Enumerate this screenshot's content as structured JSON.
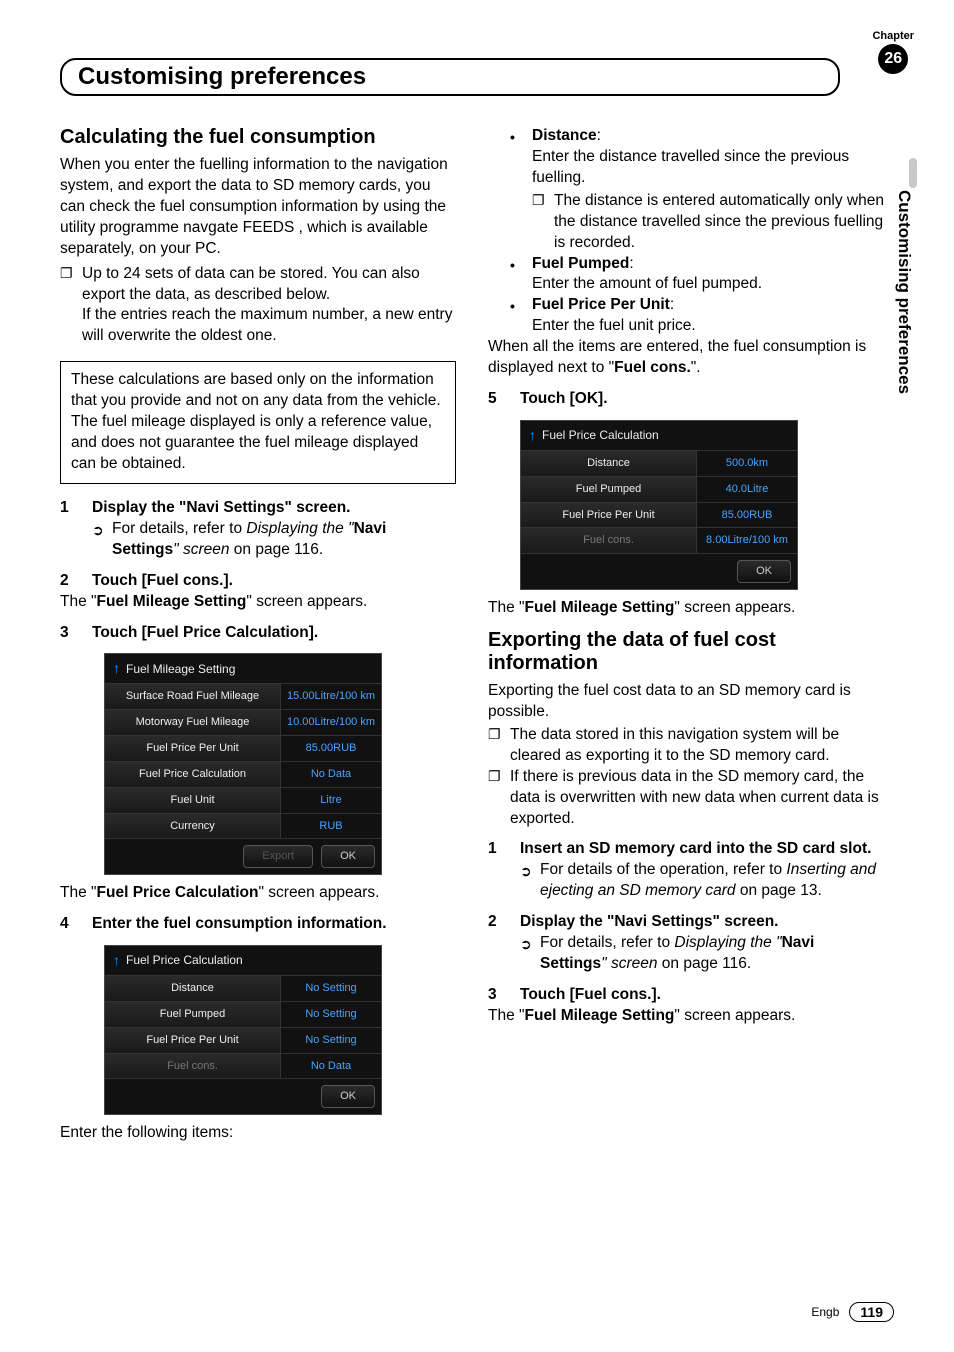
{
  "chapter": {
    "label": "Chapter",
    "number": "26"
  },
  "page_title": "Customising preferences",
  "side_label": "Customising preferences",
  "footer": {
    "lang": "Engb",
    "page": "119"
  },
  "left": {
    "h2": "Calculating the fuel consumption",
    "intro": "When you enter the fuelling information to the navigation system, and export the data to SD memory cards, you can check the fuel consumption information by using the utility programme navgate FEEDS , which is available separately, on your PC.",
    "note1a": "Up to 24 sets of data can be stored. You can also export the data, as described below.",
    "note1b": "If the entries reach the maximum number, a new entry will overwrite the oldest one.",
    "boxed": "These calculations are based only on the information that you provide and not on any data from the vehicle. The fuel mileage displayed is only a reference value, and does not guarantee the fuel mileage displayed can be obtained.",
    "step1": "Display the \"Navi Settings\" screen.",
    "step1_ref_a": "For details, refer to ",
    "step1_ref_i": "Displaying the \"",
    "step1_ref_b": "Navi Settings",
    "step1_ref_c": "\" screen",
    "step1_ref_d": " on page 116.",
    "step2": "Touch [Fuel cons.].",
    "step2_after_a": "The \"",
    "step2_after_b": "Fuel Mileage Setting",
    "step2_after_c": "\" screen appears.",
    "step3": "Touch [Fuel Price Calculation].",
    "ss1": {
      "title": "Fuel Mileage Setting",
      "rows": [
        {
          "k": "Surface Road Fuel Mileage",
          "v": "15.00Litre/100 km"
        },
        {
          "k": "Motorway Fuel Mileage",
          "v": "10.00Litre/100 km"
        },
        {
          "k": "Fuel Price Per Unit",
          "v": "85.00RUB"
        },
        {
          "k": "Fuel Price Calculation",
          "v": "No Data"
        },
        {
          "k": "Fuel Unit",
          "v": "Litre"
        },
        {
          "k": "Currency",
          "v": "RUB"
        }
      ],
      "btn1": "Export",
      "btn2": "OK"
    },
    "ss1_after_a": "The \"",
    "ss1_after_b": "Fuel Price Calculation",
    "ss1_after_c": "\" screen appears.",
    "step4": "Enter the fuel consumption information.",
    "ss2": {
      "title": "Fuel Price Calculation",
      "rows": [
        {
          "k": "Distance",
          "v": "No Setting"
        },
        {
          "k": "Fuel Pumped",
          "v": "No Setting"
        },
        {
          "k": "Fuel Price Per Unit",
          "v": "No Setting"
        },
        {
          "k": "Fuel cons.",
          "v": "No Data",
          "dim": true
        }
      ],
      "btn2": "OK"
    },
    "ss2_after": "Enter the following items:"
  },
  "right": {
    "b1_label": "Distance",
    "b1_text": "Enter the distance travelled since the previous fuelling.",
    "b1_note": "The distance is entered automatically only when the distance travelled since the previous fuelling is recorded.",
    "b2_label": "Fuel Pumped",
    "b2_text": "Enter the amount of fuel pumped.",
    "b3_label": "Fuel Price Per Unit",
    "b3_text": "Enter the fuel unit price.",
    "after_bullets_a": "When all the items are entered, the fuel consumption is displayed next to \"",
    "after_bullets_b": "Fuel cons.",
    "after_bullets_c": "\".",
    "step5": "Touch [OK].",
    "ss3": {
      "title": "Fuel Price Calculation",
      "rows": [
        {
          "k": "Distance",
          "v": "500.0km"
        },
        {
          "k": "Fuel Pumped",
          "v": "40.0Litre"
        },
        {
          "k": "Fuel Price Per Unit",
          "v": "85.00RUB"
        },
        {
          "k": "Fuel cons.",
          "v": "8.00Litre/100 km",
          "dim": true
        }
      ],
      "btn2": "OK"
    },
    "ss3_after_a": "The \"",
    "ss3_after_b": "Fuel Mileage Setting",
    "ss3_after_c": "\" screen appears.",
    "h2b": "Exporting the data of fuel cost information",
    "h2b_intro": "Exporting the fuel cost data to an SD memory card is possible.",
    "h2b_note1": "The data stored in this navigation system will be cleared as exporting it to the SD memory card.",
    "h2b_note2": "If there is previous data in the SD memory card, the data is overwritten with new data when current data is exported.",
    "estep1": "Insert an SD memory card into the SD card slot.",
    "estep1_ref_a": "For details of the operation, refer to ",
    "estep1_ref_i": "Inserting and ejecting an SD memory card",
    "estep1_ref_b": " on page 13.",
    "estep2": "Display the \"Navi Settings\" screen.",
    "estep2_ref_a": "For details, refer to ",
    "estep2_ref_i": "Displaying the \"",
    "estep2_ref_b": "Navi Settings",
    "estep2_ref_c": "\" screen",
    "estep2_ref_d": " on page 116.",
    "estep3": "Touch [Fuel cons.].",
    "estep3_after_a": "The \"",
    "estep3_after_b": "Fuel Mileage Setting",
    "estep3_after_c": "\" screen appears."
  }
}
